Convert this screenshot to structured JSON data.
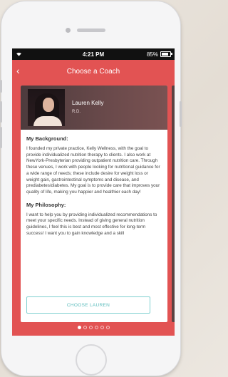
{
  "status_bar": {
    "time": "4:21 PM",
    "battery": "85%"
  },
  "nav": {
    "title": "Choose a Coach",
    "back_icon": "chevron-left-icon"
  },
  "coach": {
    "name": "Lauren Kelly",
    "credential": "R.D.",
    "background_heading": "My Background:",
    "background_text": "I founded my private practice, Kelly Wellness, with the goal to provide individualized nutrition therapy to clients. I also work at NewYork-Presbyterian providing outpatient nutrition care. Through these venues, I work with people looking for nutritional guidance for a wide range of needs; these include desire for weight loss or weight gain, gastrointestinal symptoms and disease, and prediabetes/diabetes. My goal is to provide care that improves your quality of life, making you happier and healthier each day!",
    "philosophy_heading": "My Philosophy:",
    "philosophy_text": "I want to help you by providing individualized recommendations to meet your specific needs. Instead of giving general nutrition guidelines, I feel this is best and most effective for long-term success! I want you to gain knowledge and a skill",
    "choose_button": "CHOOSE LAUREN"
  },
  "pagination": {
    "total": 6,
    "active_index": 0
  },
  "colors": {
    "accent": "#e25353",
    "button_teal": "#5bbcbc"
  }
}
